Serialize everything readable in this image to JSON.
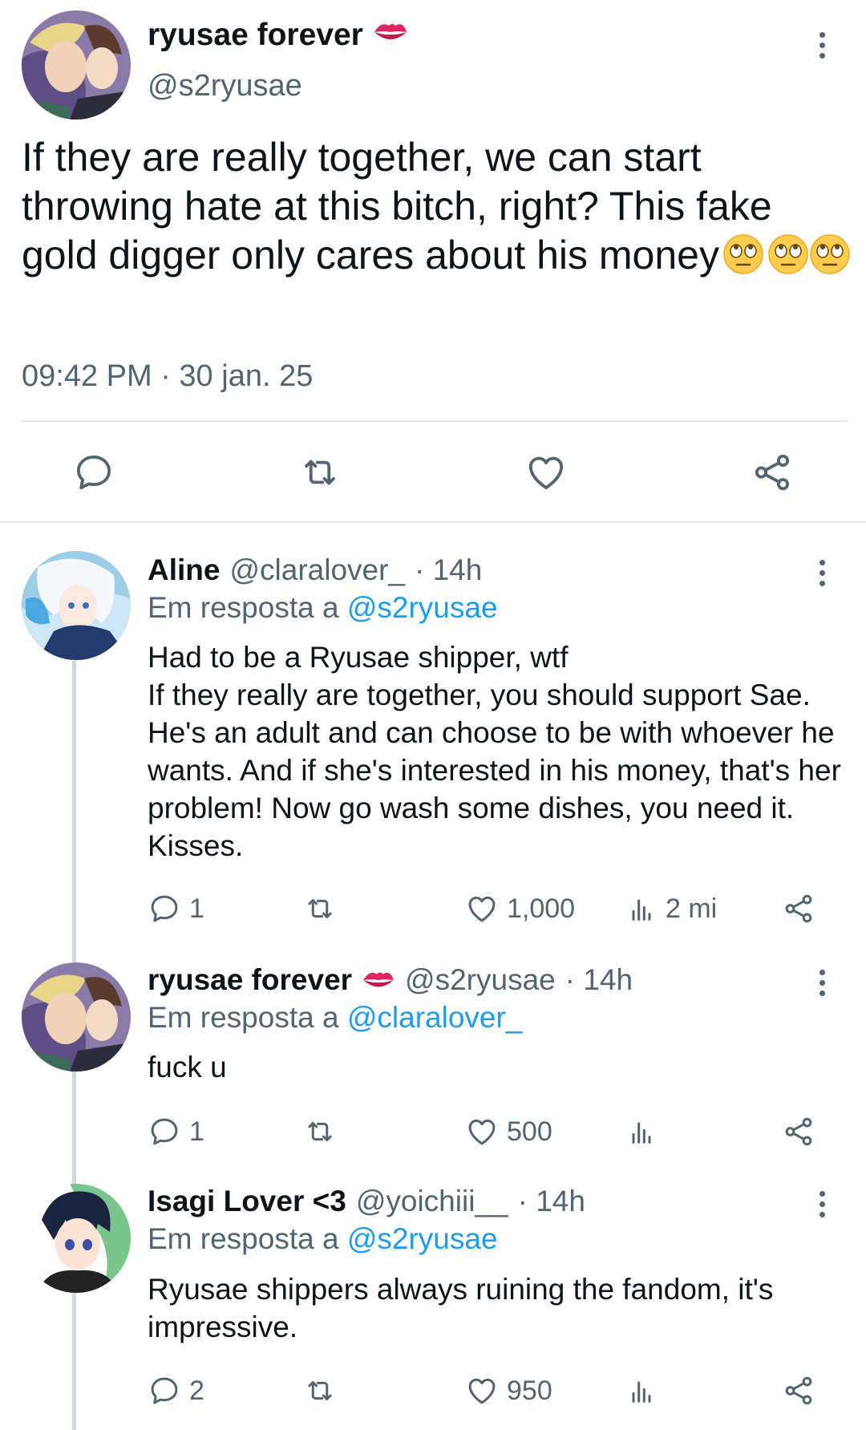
{
  "main_tweet": {
    "display_name": "ryusae forever",
    "handle": "@s2ryusae",
    "text": "If they are really together, we can start throwing hate at this bitch, right? This fake gold digger only cares about his money",
    "emoji_icon": "face-with-rolling-eyes",
    "timestamp": "09:42 PM · 30 jan. 25"
  },
  "replies": [
    {
      "display_name": "Aline",
      "handle": "@claralover_",
      "age": "· 14h",
      "reply_prefix": "Em resposta a",
      "reply_to": "@s2ryusae",
      "text": "Had to be a Ryusae shipper, wtf\nIf they really are together, you should support Sae. He's an adult and can choose to be with whoever he wants. And if she's interested in his money, that's her problem! Now go wash some dishes, you need it. Kisses.",
      "replies_count": "1",
      "likes_count": "1,000",
      "views_count": "2 mi"
    },
    {
      "display_name": "ryusae forever",
      "handle": "@s2ryusae",
      "age": "· 14h",
      "reply_prefix": "Em resposta a",
      "reply_to": "@claralover_",
      "text": "fuck u",
      "replies_count": "1",
      "likes_count": "500",
      "views_count": ""
    },
    {
      "display_name": "Isagi Lover <3",
      "handle": "@yoichiii__",
      "age": "· 14h",
      "reply_prefix": "Em resposta a",
      "reply_to": "@s2ryusae",
      "text": "Ryusae shippers always ruining the fandom, it's impressive.",
      "replies_count": "2",
      "likes_count": "950",
      "views_count": ""
    }
  ],
  "colors": {
    "text": "#0f1419",
    "secondary": "#536471",
    "mention": "#1d9bf0",
    "divider": "#e3e7ea",
    "kiss_icon": "#e0245e"
  }
}
